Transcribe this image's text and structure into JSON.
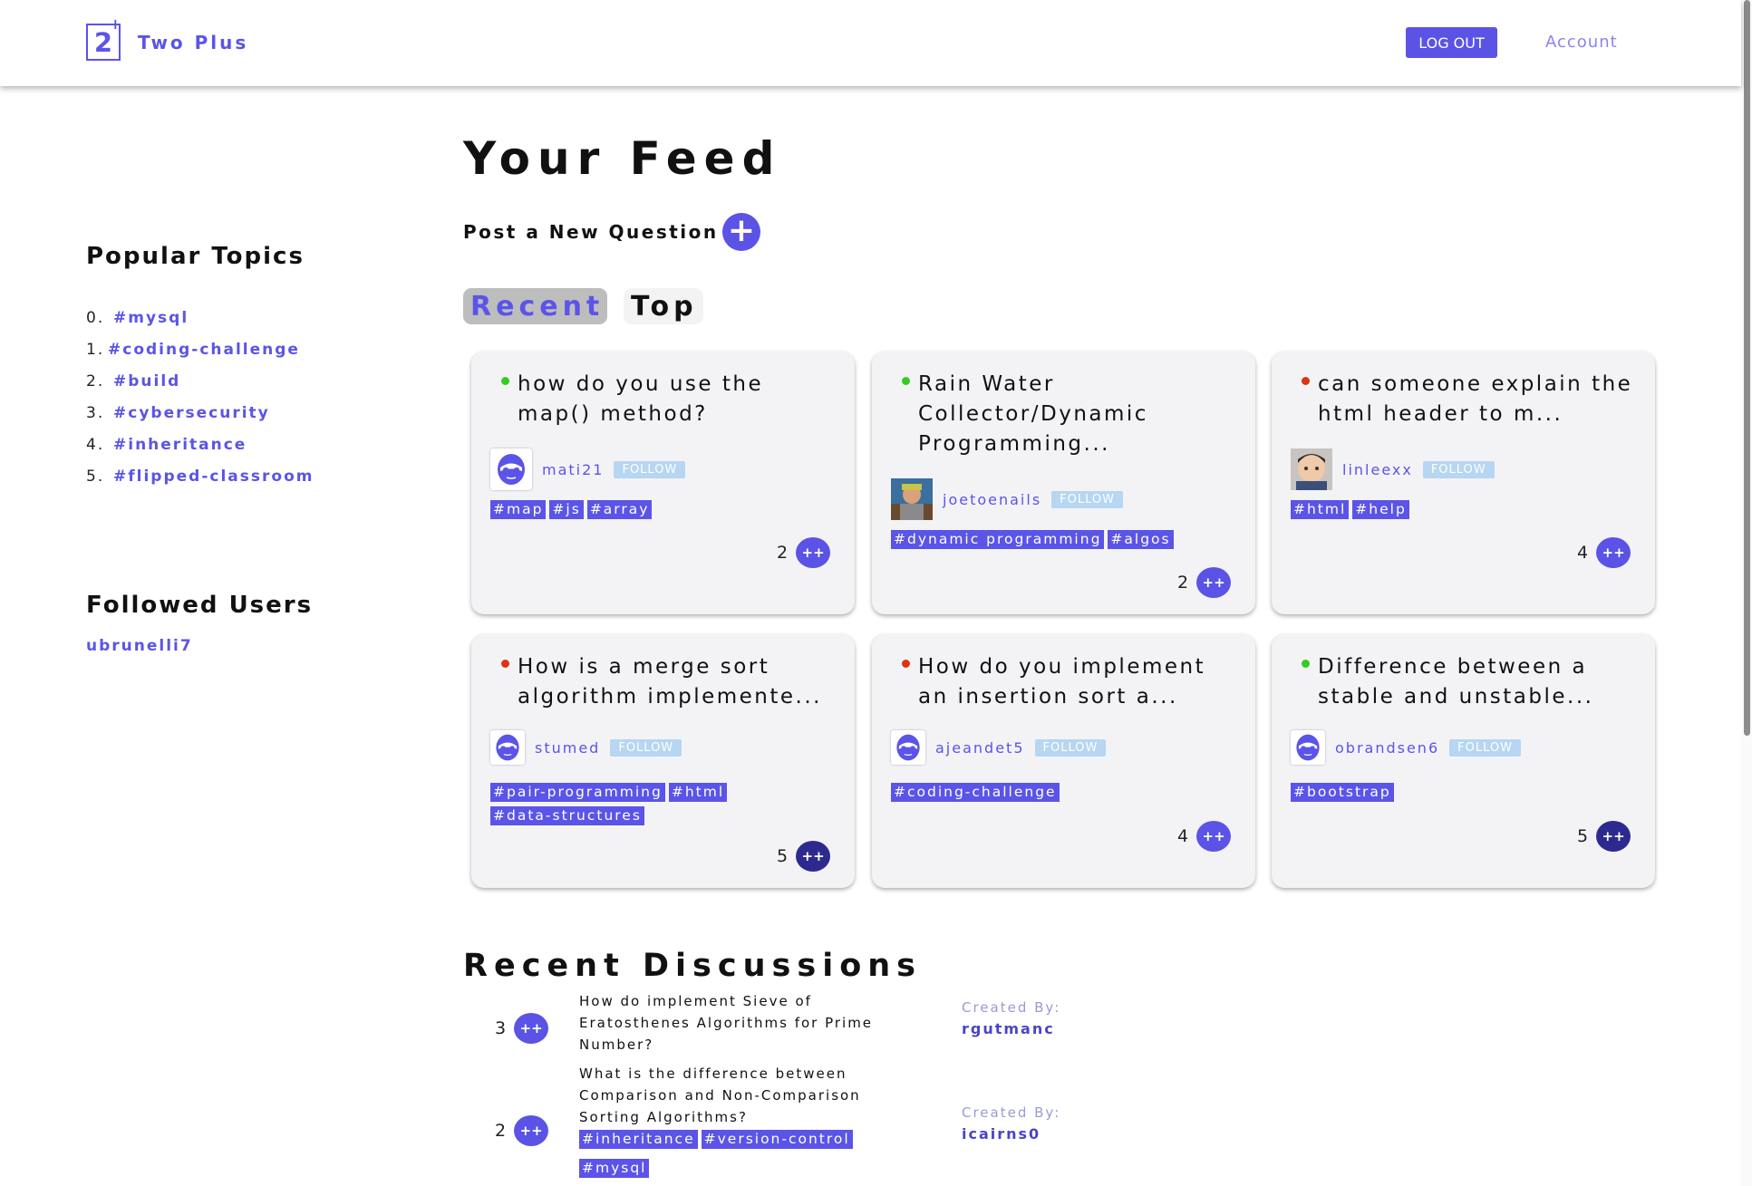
{
  "app": {
    "logo_mark": "2",
    "logo_plus": "+",
    "name": "Two Plus"
  },
  "header": {
    "logout_label": "LOG OUT",
    "account_label": "Account"
  },
  "sidebar": {
    "popular_heading": "Popular Topics",
    "topics": [
      {
        "num": "0.",
        "tag": "#mysql"
      },
      {
        "num": "1.",
        "tag": "#coding-challenge"
      },
      {
        "num": "2.",
        "tag": "#build"
      },
      {
        "num": "3.",
        "tag": "#cybersecurity"
      },
      {
        "num": "4.",
        "tag": "#inheritance"
      },
      {
        "num": "5.",
        "tag": "#flipped-classroom"
      }
    ],
    "followed_heading": "Followed Users",
    "followed_users": [
      "ubrunelli7"
    ]
  },
  "main": {
    "title": "Your Feed",
    "post_label": "Post a New Question",
    "post_button": "+",
    "tabs": [
      {
        "label": "Recent",
        "active": true
      },
      {
        "label": "Top",
        "active": false
      }
    ],
    "follow_label": "FOLLOW",
    "vote_label": "++",
    "cards": [
      {
        "title": "how do you use the map() method?",
        "status_color": "#33cc22",
        "author": "mati21",
        "avatar": "anon-mask-icon",
        "tags": [
          "#map",
          "#js",
          "#array"
        ],
        "votes": "2"
      },
      {
        "title": "Rain Water Collector/Dynamic Programming...",
        "status_color": "#33cc22",
        "author": "joetoenails",
        "avatar": "user-photo",
        "tags": [
          "#dynamic programming",
          "#algos"
        ],
        "votes": "2"
      },
      {
        "title": "can someone explain the html header to m...",
        "status_color": "#dd3311",
        "author": "linleexx",
        "avatar": "user-photo",
        "tags": [
          "#html",
          "#help"
        ],
        "votes": "4"
      },
      {
        "title": "How is a merge sort algorithm implemente...",
        "status_color": "#dd3311",
        "author": "stumed",
        "avatar": "anon-mask-icon",
        "tags": [
          "#pair-programming",
          "#html",
          "#data-structures"
        ],
        "votes": "5"
      },
      {
        "title": "How do you implement an insertion sort a...",
        "status_color": "#dd3311",
        "author": "ajeandet5",
        "avatar": "anon-mask-icon",
        "tags": [
          "#coding-challenge"
        ],
        "votes": "4"
      },
      {
        "title": "Difference between a stable and unstable...",
        "status_color": "#33cc22",
        "author": "obrandsen6",
        "avatar": "anon-mask-icon",
        "tags": [
          "#bootstrap"
        ],
        "votes": "5"
      }
    ]
  },
  "recent": {
    "title": "Recent Discussions",
    "created_label": "Created By:",
    "items": [
      {
        "votes": "3",
        "question": "How do implement Sieve of Eratosthenes Algorithms for Prime Number?",
        "user": "rgutmanc",
        "tags": []
      },
      {
        "votes": "2",
        "question": "What is the difference between Comparison and Non-Comparison Sorting Algorithms?",
        "user": "icairns0",
        "tags": [
          "#inheritance",
          "#version-control",
          "#mysql"
        ]
      }
    ]
  },
  "colors": {
    "accent": "#5b54e8",
    "status_green": "#33cc22",
    "status_red": "#dd3311",
    "follow_bg": "#b6d6f2"
  }
}
